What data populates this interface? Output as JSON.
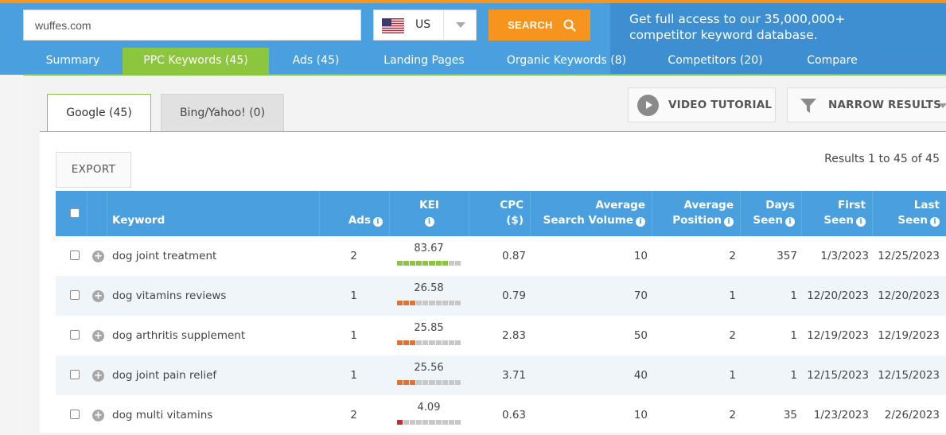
{
  "search": {
    "value": "wuffes.com",
    "button_label": "SEARCH"
  },
  "country": {
    "code": "US"
  },
  "promo": {
    "line1": "Get full access to our 35,000,000+",
    "line2": "competitor keyword database."
  },
  "nav": {
    "tabs": [
      {
        "label": "Summary"
      },
      {
        "label": "PPC Keywords (45)"
      },
      {
        "label": "Ads (45)"
      },
      {
        "label": "Landing Pages"
      },
      {
        "label": "Organic Keywords (8)"
      },
      {
        "label": "Competitors (20)"
      },
      {
        "label": "Compare"
      }
    ],
    "active_index": 1
  },
  "engine_tabs": [
    {
      "label": "Google (45)"
    },
    {
      "label": "Bing/Yahoo! (0)"
    }
  ],
  "toolbar": {
    "video_label": "VIDEO TUTORIAL",
    "narrow_label": "NARROW RESULTS",
    "export_label": "EXPORT"
  },
  "results_text": "Results 1 to 45 of 45",
  "table": {
    "headers": {
      "keyword": "Keyword",
      "ads": "Ads",
      "kei": "KEI",
      "cpc_1": "CPC",
      "cpc_2": "($)",
      "vol_1": "Average",
      "vol_2": "Search Volume",
      "pos_1": "Average",
      "pos_2": "Position",
      "days_1": "Days",
      "days_2": "Seen",
      "first_1": "First",
      "first_2": "Seen",
      "last_1": "Last",
      "last_2": "Seen"
    },
    "rows": [
      {
        "keyword": "dog joint treatment",
        "ads": "2",
        "kei": "83.67",
        "kei_level": 0.8367,
        "kei_color": "#8cc63f",
        "cpc": "0.87",
        "volume": "10",
        "position": "2",
        "days": "357",
        "first": "1/3/2023",
        "last": "12/25/2023"
      },
      {
        "keyword": "dog vitamins reviews",
        "ads": "1",
        "kei": "26.58",
        "kei_level": 0.2658,
        "kei_color": "#e8702a",
        "cpc": "0.79",
        "volume": "70",
        "position": "1",
        "days": "1",
        "first": "12/20/2023",
        "last": "12/20/2023"
      },
      {
        "keyword": "dog arthritis supplement",
        "ads": "1",
        "kei": "25.85",
        "kei_level": 0.2585,
        "kei_color": "#e8702a",
        "cpc": "2.83",
        "volume": "50",
        "position": "2",
        "days": "1",
        "first": "12/19/2023",
        "last": "12/19/2023"
      },
      {
        "keyword": "dog joint pain relief",
        "ads": "1",
        "kei": "25.56",
        "kei_level": 0.2556,
        "kei_color": "#e8702a",
        "cpc": "3.71",
        "volume": "40",
        "position": "1",
        "days": "1",
        "first": "12/15/2023",
        "last": "12/15/2023"
      },
      {
        "keyword": "dog multi vitamins",
        "ads": "2",
        "kei": "4.09",
        "kei_level": 0.0409,
        "kei_color": "#cc2a2a",
        "cpc": "0.63",
        "volume": "10",
        "position": "2",
        "days": "35",
        "first": "1/23/2023",
        "last": "2/26/2023"
      }
    ]
  },
  "colors": {
    "brand_blue": "#4aa0de",
    "accent_orange": "#f7941e",
    "accent_green": "#8cc63f"
  }
}
